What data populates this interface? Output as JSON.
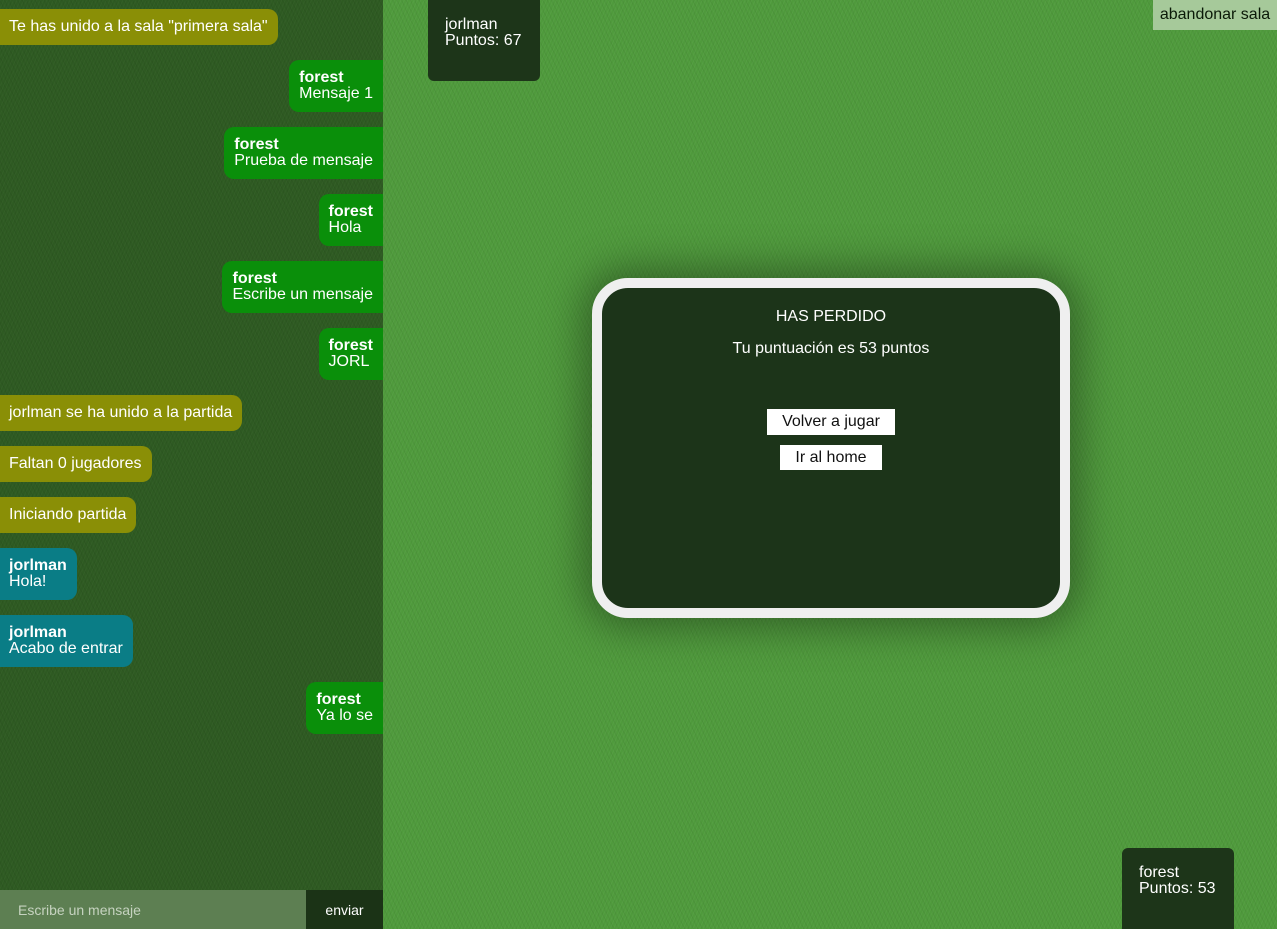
{
  "chat": {
    "messages": [
      {
        "type": "system",
        "text": "Te has unido a la sala \"primera sala\""
      },
      {
        "type": "own",
        "author": "forest",
        "text": "Mensaje 1"
      },
      {
        "type": "own",
        "author": "forest",
        "text": "Prueba de mensaje"
      },
      {
        "type": "own",
        "author": "forest",
        "text": "Hola"
      },
      {
        "type": "own",
        "author": "forest",
        "text": "Escribe un mensaje"
      },
      {
        "type": "own",
        "author": "forest",
        "text": "JORL"
      },
      {
        "type": "system",
        "text": "jorlman se ha unido a la partida"
      },
      {
        "type": "system",
        "text": "Faltan 0 jugadores"
      },
      {
        "type": "system",
        "text": "Iniciando partida"
      },
      {
        "type": "other",
        "author": "jorlman",
        "text": "Hola!"
      },
      {
        "type": "other",
        "author": "jorlman",
        "text": "Acabo de entrar"
      },
      {
        "type": "own",
        "author": "forest",
        "text": "Ya lo se"
      }
    ],
    "input_placeholder": "Escribe un mensaje",
    "send_label": "enviar"
  },
  "opponent": {
    "name": "jorlman",
    "points_text": "Puntos: 67"
  },
  "player": {
    "name": "forest",
    "points_text": "Puntos: 53"
  },
  "leave_label": "abandonar sala",
  "modal": {
    "title": "HAS PERDIDO",
    "score_text": "Tu puntuación es 53 puntos",
    "play_again_label": "Volver a jugar",
    "home_label": "Ir al home"
  },
  "colors": {
    "system_bubble": "#8a8f06",
    "own_bubble": "#0a8f0a",
    "other_bubble": "#0a7d86",
    "table_green": "#4f9a3c",
    "dark_panel": "#1d3519"
  }
}
